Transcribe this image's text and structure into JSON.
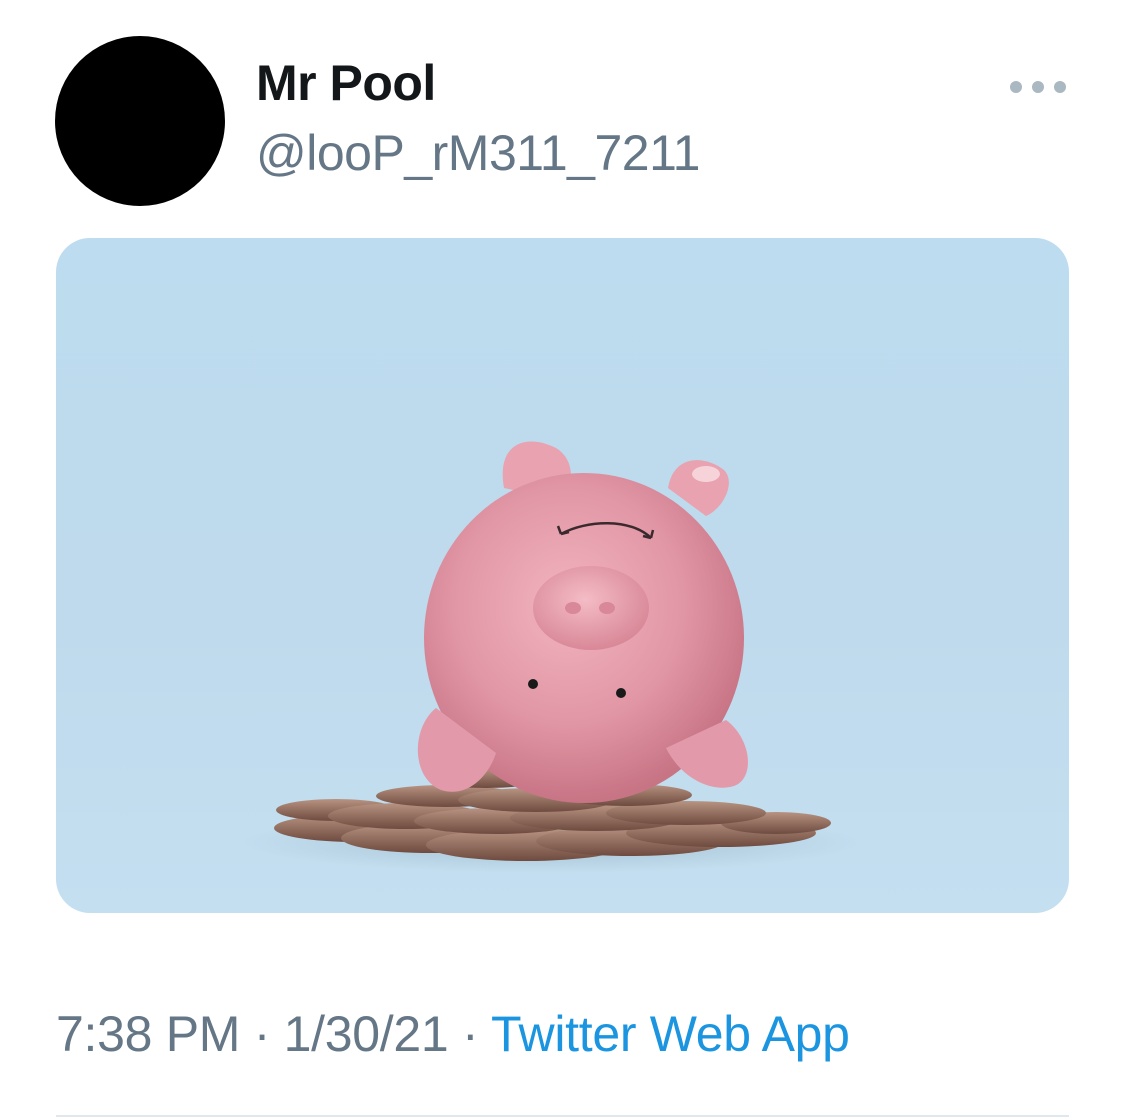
{
  "tweet": {
    "author": {
      "display_name": "Mr Pool",
      "handle": "@looP_rM311_7211"
    },
    "more_icon": "more-horizontal-icon",
    "media": {
      "subject": "piggy-bank"
    },
    "time": "7:38 PM",
    "date": "1/30/21",
    "separator": "·",
    "source": "Twitter Web App"
  },
  "colors": {
    "text_primary": "#14171a",
    "text_secondary": "#657786",
    "link": "#1b95e0",
    "avatar": "#000000",
    "media_background": "#bddcef",
    "pig": "#e59aa8"
  }
}
